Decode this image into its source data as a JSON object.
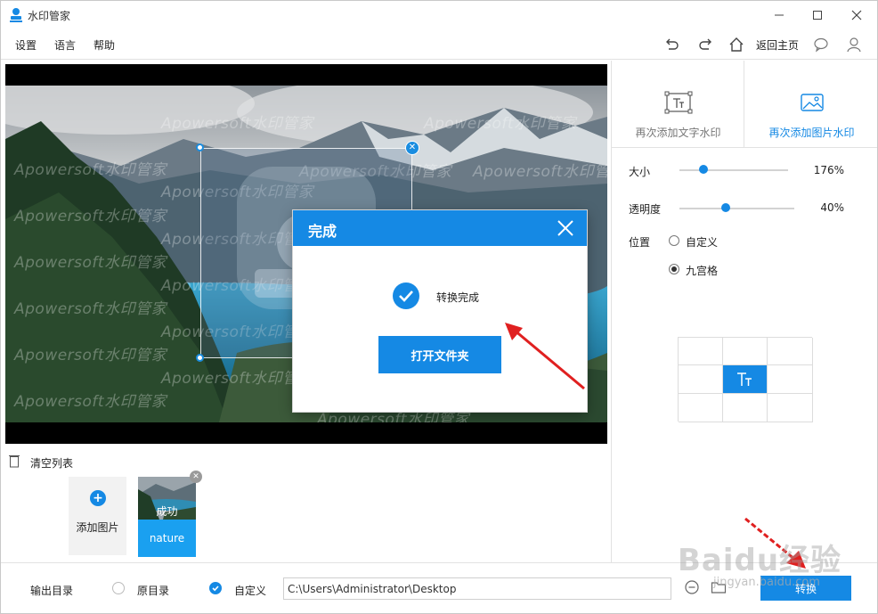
{
  "window": {
    "title": "水印管家"
  },
  "menu": {
    "items": [
      "设置",
      "语言",
      "帮助"
    ],
    "home_label": "返回主页"
  },
  "preview": {
    "watermark_text": "Apowersoft水印管家"
  },
  "dialog": {
    "title": "完成",
    "message": "转换完成",
    "open_folder_label": "打开文件夹"
  },
  "file_list": {
    "clear_label": "清空列表",
    "add_label": "添加图片",
    "items": [
      {
        "name": "nature",
        "status": "成功"
      }
    ]
  },
  "side_panel": {
    "tabs": [
      {
        "label": "再次添加文字水印",
        "active": false
      },
      {
        "label": "再次添加图片水印",
        "active": true
      }
    ],
    "size": {
      "label": "大小",
      "value": "176%",
      "fraction": 0.22
    },
    "opacity": {
      "label": "透明度",
      "value": "40%",
      "fraction": 0.4
    },
    "position": {
      "label": "位置",
      "options": [
        {
          "label": "自定义",
          "selected": false
        },
        {
          "label": "九宫格",
          "selected": true
        }
      ],
      "grid_selected_index": 4
    }
  },
  "bottom": {
    "output_label": "输出目录",
    "option_original": "原目录",
    "option_custom": "自定义",
    "path_value": "C:\\Users\\Administrator\\Desktop",
    "convert_label": "转换"
  },
  "overlay": {
    "baidu_logo": "Baidu经验",
    "baidu_url": "jingyan.baidu.com"
  },
  "colors": {
    "accent": "#1589e4",
    "thumb_name_bg": "#1aa0f0"
  }
}
